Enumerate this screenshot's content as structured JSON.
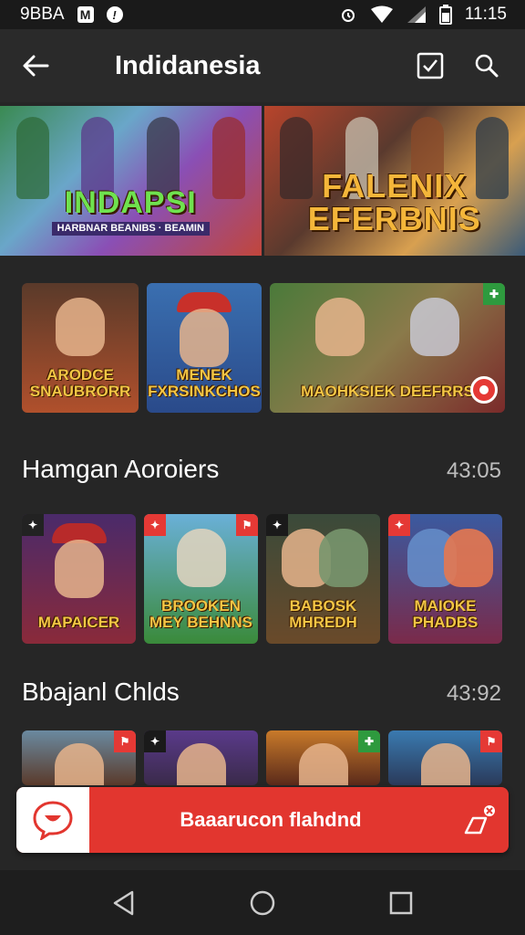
{
  "status_bar": {
    "left_text": "9BBA",
    "left_icon_1": "M",
    "left_icon_2": "!",
    "time": "11:15",
    "icons": [
      "alarm-icon",
      "wifi-icon",
      "signal-icon",
      "battery-icon"
    ]
  },
  "app_bar": {
    "title": "Indidanesia",
    "actions": [
      "checkbox-icon",
      "search-icon"
    ]
  },
  "banner": [
    {
      "title": "INDAPSI",
      "subtitle": "HARBNAR BEANIBS · BEAMIN"
    },
    {
      "title": "FALENIX EFERBNIS",
      "subtitle": ""
    }
  ],
  "featured_row": [
    {
      "label": "ARODCE SNAUBRORR"
    },
    {
      "label": "MENEK FXRSINKCHOS"
    },
    {
      "label": "MAOHKSIEK DEEFRRS"
    }
  ],
  "sections": [
    {
      "title": "Hamgan Aoroiers",
      "time": "43:05",
      "tiles": [
        {
          "label": "MAPAICER"
        },
        {
          "label": "BROOKEN MEY BEHNNS"
        },
        {
          "label": "BABOSK MHREDH"
        },
        {
          "label": "MAIOKE PHADBS"
        }
      ]
    },
    {
      "title": "Bbajanl Chlds",
      "time": "43:92",
      "tiles": [
        {
          "label": ""
        },
        {
          "label": ""
        },
        {
          "label": ""
        },
        {
          "label": ""
        }
      ]
    }
  ],
  "bottom_banner": {
    "text": "Baaarucon flahdnd"
  },
  "colors": {
    "background": "#262626",
    "accent_red": "#e2362f",
    "title_gold": "#f3c645"
  }
}
